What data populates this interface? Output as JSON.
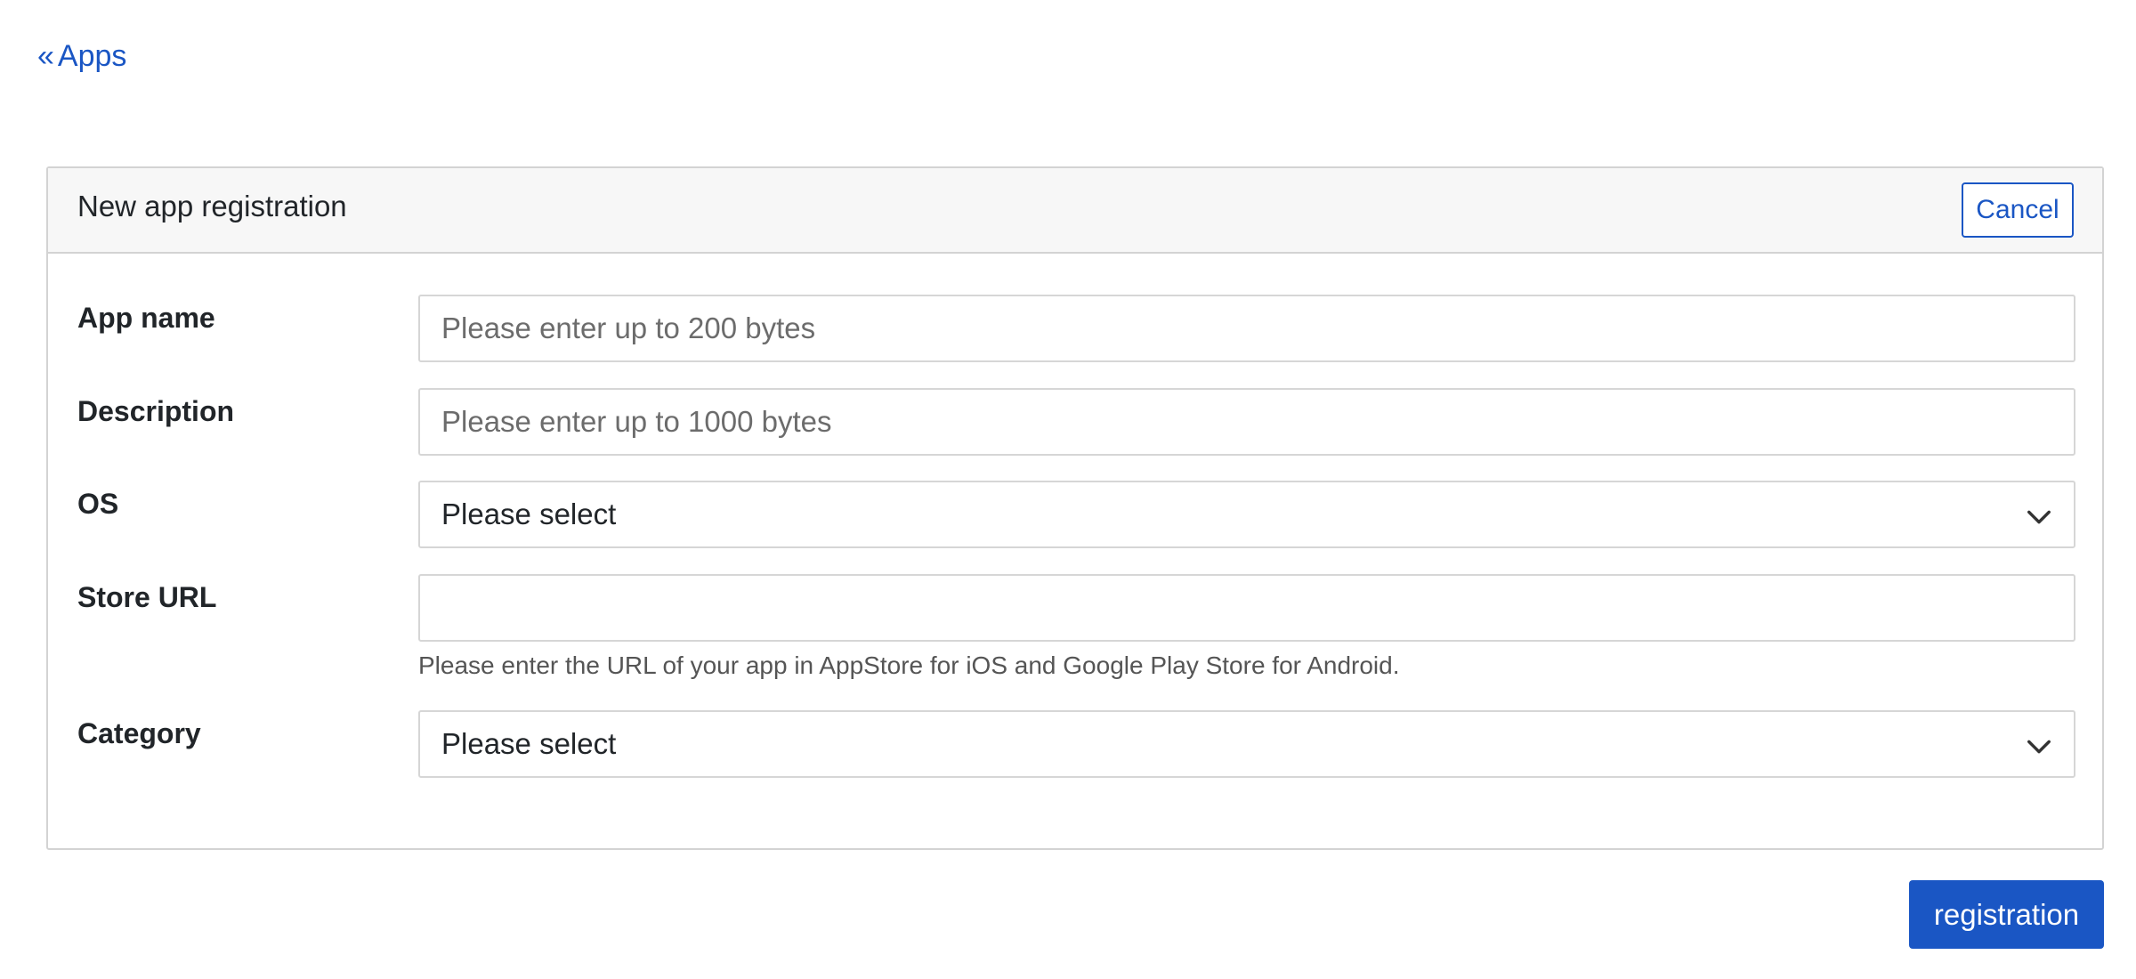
{
  "nav": {
    "back_glyph": "«",
    "back_label": "Apps"
  },
  "card": {
    "title": "New app registration",
    "cancel_label": "Cancel"
  },
  "form": {
    "app_name": {
      "label": "App name",
      "value": "",
      "placeholder": "Please enter up to 200 bytes"
    },
    "description": {
      "label": "Description",
      "value": "",
      "placeholder": "Please enter up to 1000 bytes"
    },
    "os": {
      "label": "OS",
      "selected": "Please select",
      "icon": "chevron-down-icon"
    },
    "store_url": {
      "label": "Store URL",
      "value": "",
      "placeholder": "",
      "help": "Please enter the URL of your app in AppStore for iOS and Google Play Store for Android."
    },
    "category": {
      "label": "Category",
      "selected": "Please select",
      "icon": "chevron-down-icon"
    }
  },
  "actions": {
    "register_label": "registration"
  },
  "colors": {
    "primary": "#1a56c4",
    "header_bg": "#f7f7f7",
    "border": "#d3d3d3"
  }
}
